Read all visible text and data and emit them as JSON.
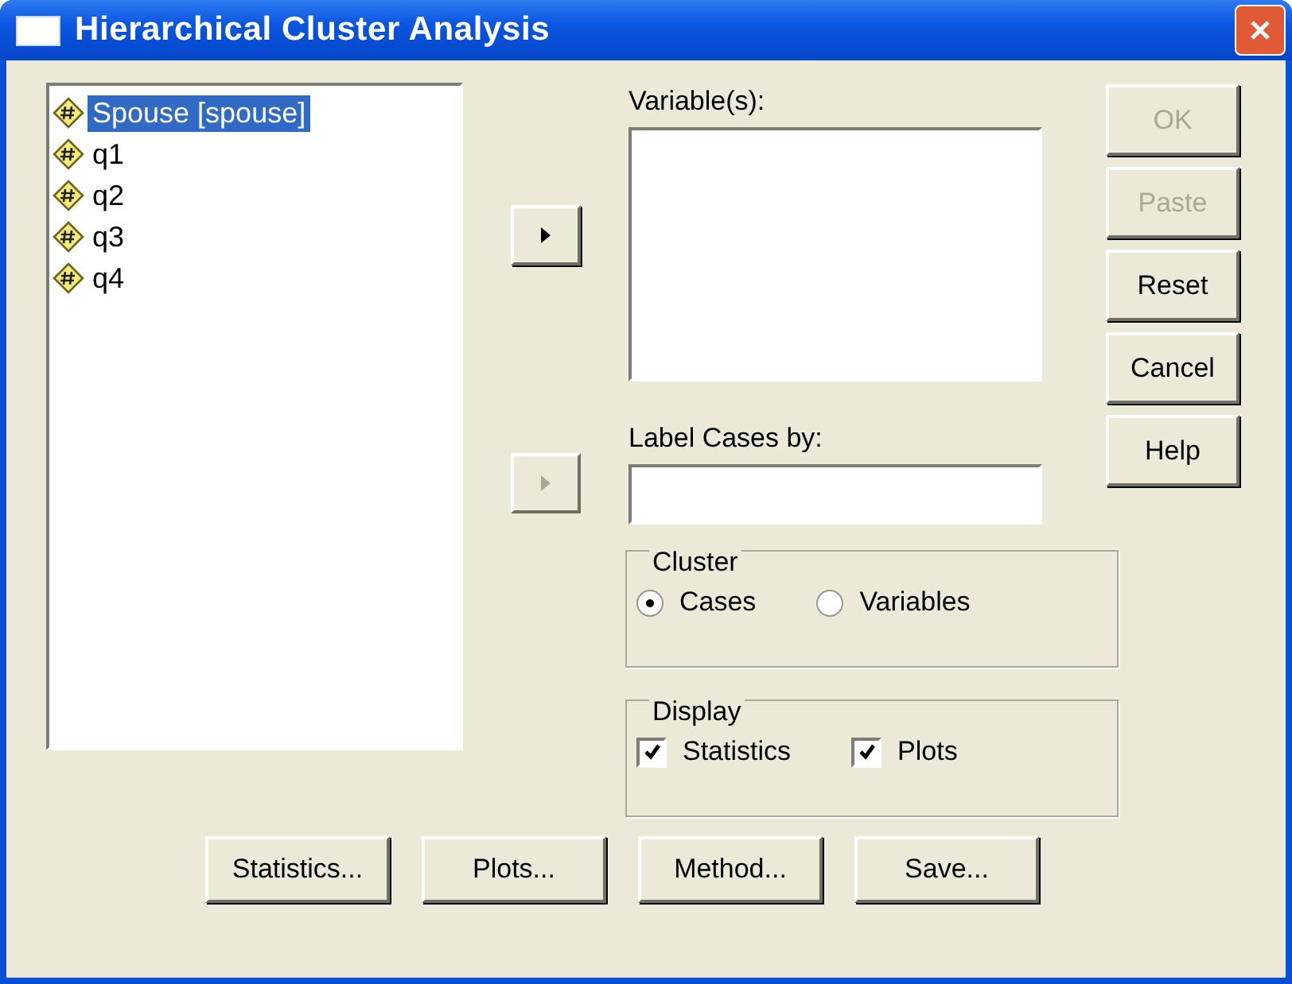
{
  "window": {
    "title": "Hierarchical Cluster Analysis"
  },
  "source_list": {
    "items": [
      {
        "label": "Spouse [spouse]",
        "selected": true
      },
      {
        "label": "q1",
        "selected": false
      },
      {
        "label": "q2",
        "selected": false
      },
      {
        "label": "q3",
        "selected": false
      },
      {
        "label": "q4",
        "selected": false
      }
    ]
  },
  "move_buttons": [
    {
      "disabled": false
    },
    {
      "disabled": true
    }
  ],
  "variables": {
    "label": "Variable(s):"
  },
  "label_cases": {
    "label": "Label Cases by:"
  },
  "cluster": {
    "title": "Cluster",
    "options": [
      {
        "label": "Cases",
        "selected": true
      },
      {
        "label": "Variables",
        "selected": false
      }
    ]
  },
  "display": {
    "title": "Display",
    "options": [
      {
        "label": "Statistics",
        "checked": true
      },
      {
        "label": "Plots",
        "checked": true
      }
    ]
  },
  "action_buttons": [
    {
      "label": "OK",
      "disabled": true
    },
    {
      "label": "Paste",
      "disabled": true
    },
    {
      "label": "Reset",
      "disabled": false
    },
    {
      "label": "Cancel",
      "disabled": false
    },
    {
      "label": "Help",
      "disabled": false
    }
  ],
  "bottom_buttons": [
    {
      "label": "Statistics..."
    },
    {
      "label": "Plots..."
    },
    {
      "label": "Method..."
    },
    {
      "label": "Save..."
    }
  ]
}
